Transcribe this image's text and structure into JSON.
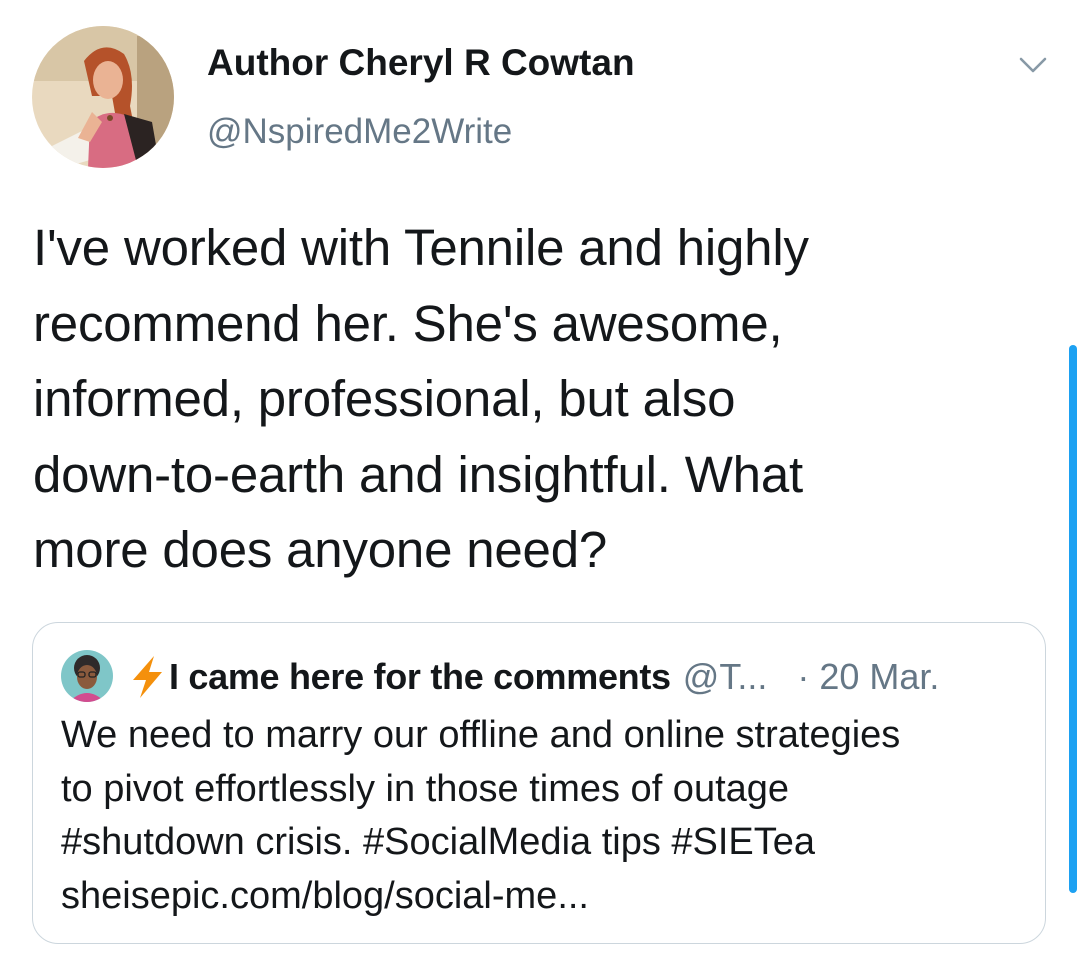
{
  "tweet": {
    "author": {
      "display_name": "Author Cheryl R Cowtan",
      "handle": "@NspiredMe2Write",
      "avatar_icon": "profile-photo"
    },
    "menu_icon": "chevron-down-icon",
    "text": "I've worked with Tennile and highly\nrecommend her. She's awesome,\ninformed, professional, but also\ndown-to-earth and insightful. What\nmore does anyone need?"
  },
  "quoted_tweet": {
    "avatar_icon": "profile-photo",
    "emoji_icon": "lightning-bolt-icon",
    "display_name": "I came here for the comments",
    "handle": "@T...",
    "separator": "·",
    "date": "20 Mar.",
    "text": "We need to marry our offline and online strategies\nto pivot effortlessly in those times of outage\n#shutdown crisis. #SocialMedia tips #SIETea\nsheisepic.com/blog/social-me..."
  },
  "colors": {
    "primary_text": "#14171a",
    "secondary_text": "#657786",
    "border": "#ccd6dd",
    "accent": "#1da1f2",
    "bolt": "#f4900c"
  }
}
